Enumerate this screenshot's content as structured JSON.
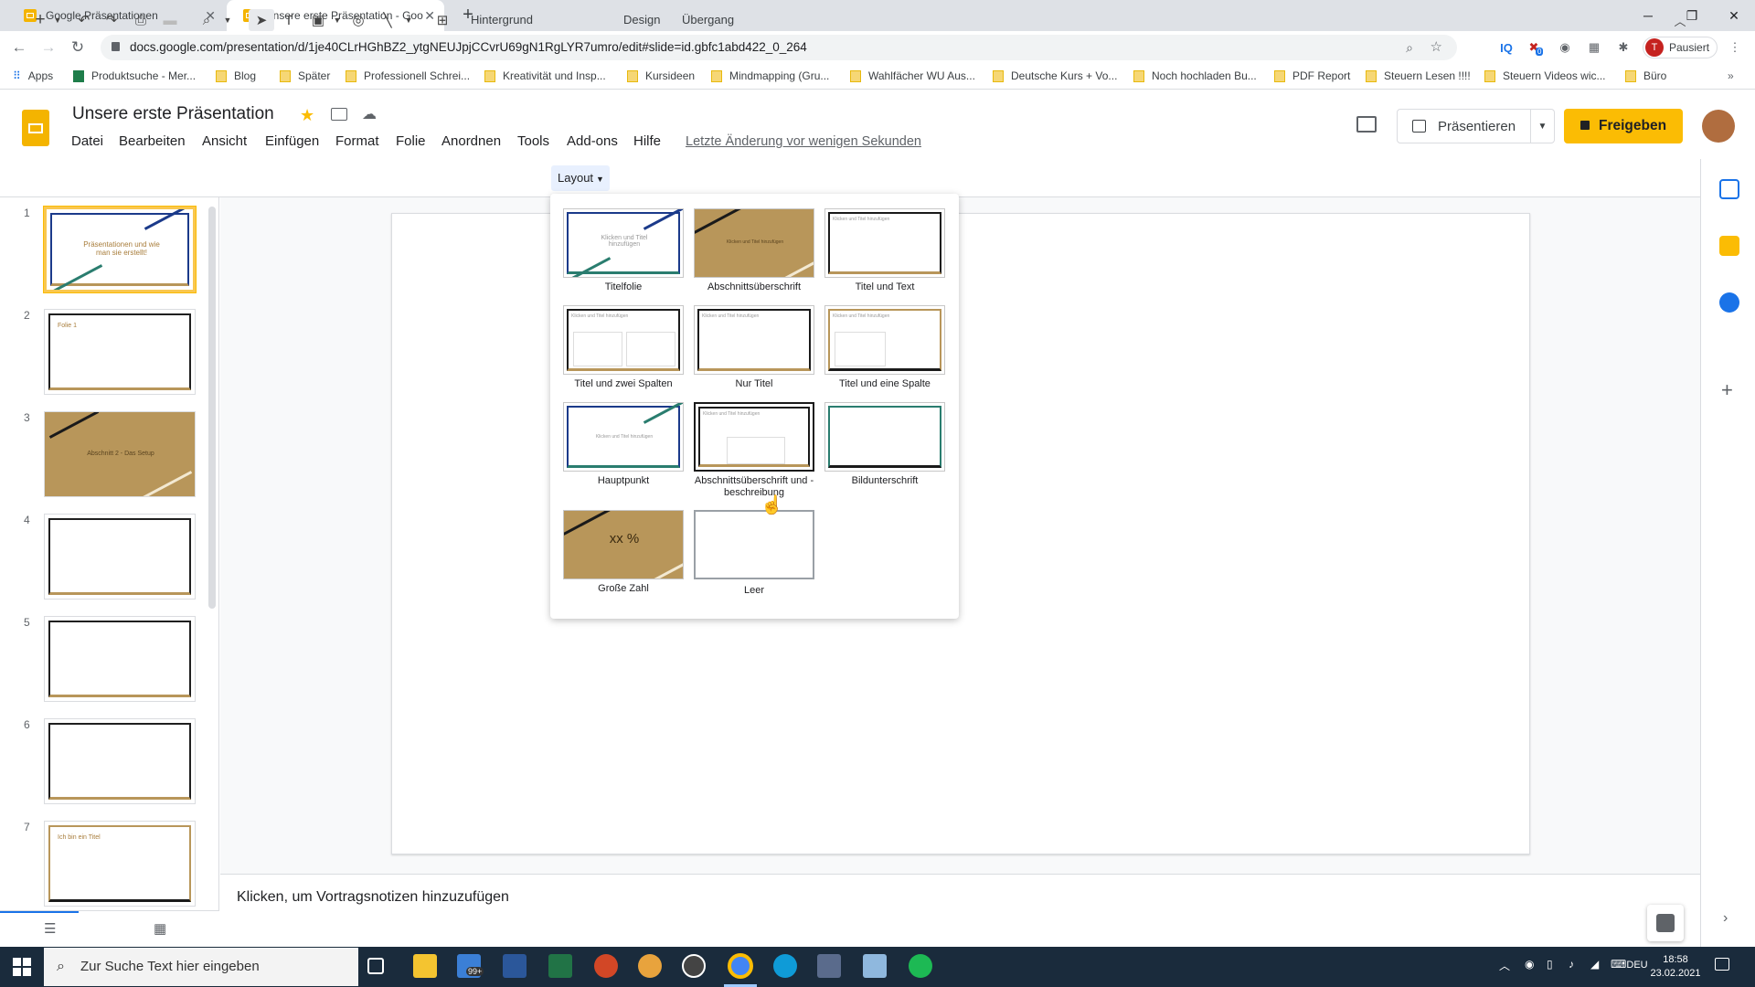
{
  "browser": {
    "tabs": [
      {
        "title": "Google Präsentationen",
        "active": false
      },
      {
        "title": "Unsere erste Präsentation - Goo",
        "active": true
      }
    ],
    "url": "docs.google.com/presentation/d/1je40CLrHGhBZ2_ytgNEUJpjCCvrU69gN1RgLYR7umro/edit#slide=id.gbfc1abd422_0_264",
    "profile_initial": "T",
    "profile_label": "Pausiert",
    "ext_badge": "0",
    "bookmarks": [
      "Apps",
      "Produktsuche - Mer...",
      "Blog",
      "Später",
      "Professionell Schrei...",
      "Kreativität und Insp...",
      "Kursideen",
      "Mindmapping  (Gru...",
      "Wahlfächer WU Aus...",
      "Deutsche Kurs + Vo...",
      "Noch hochladen Bu...",
      "PDF Report",
      "Steuern Lesen !!!!",
      "Steuern Videos wic...",
      "Büro"
    ]
  },
  "app": {
    "doc_title": "Unsere erste Präsentation",
    "menus": [
      "Datei",
      "Bearbeiten",
      "Ansicht",
      "Einfügen",
      "Format",
      "Folie",
      "Anordnen",
      "Tools",
      "Add-ons",
      "Hilfe"
    ],
    "last_edit": "Letzte Änderung vor wenigen Sekunden",
    "present_label": "Präsentieren",
    "share_label": "Freigeben"
  },
  "toolbar": {
    "background": "Hintergrund",
    "layout": "Layout",
    "design": "Design",
    "transition": "Übergang"
  },
  "filmstrip": {
    "slides": [
      {
        "num": "1",
        "text": "Präsentationen und wie man sie erstellt!"
      },
      {
        "num": "2",
        "text": "Folie 1"
      },
      {
        "num": "3",
        "text": "Abschnitt 2 - Das Setup"
      },
      {
        "num": "4",
        "text": ""
      },
      {
        "num": "5",
        "text": ""
      },
      {
        "num": "6",
        "text": ""
      },
      {
        "num": "7",
        "text": "Ich bin ein Titel"
      }
    ]
  },
  "layouts": [
    {
      "label": "Titelfolie",
      "preview": "Klicken und Titel hinzufügen"
    },
    {
      "label": "Abschnittsüberschrift",
      "preview": "Klicken und Titel hinzufügen"
    },
    {
      "label": "Titel und Text",
      "preview": "Klicken und Titel hinzufügen"
    },
    {
      "label": "Titel und zwei Spalten",
      "preview": "Klicken und Titel hinzufügen"
    },
    {
      "label": "Nur Titel",
      "preview": "Klicken und Titel hinzufügen"
    },
    {
      "label": "Titel und eine Spalte",
      "preview": "Klicken und Titel hinzufügen"
    },
    {
      "label": "Hauptpunkt",
      "preview": "Klicken und Titel hinzufügen"
    },
    {
      "label": "Abschnittsüberschrift und -beschreibung",
      "preview": "Klicken und Titel hinzufügen"
    },
    {
      "label": "Bildunterschrift",
      "preview": ""
    },
    {
      "label": "Große Zahl",
      "preview": "xx %"
    },
    {
      "label": "Leer",
      "preview": ""
    }
  ],
  "notes_placeholder": "Klicken, um Vortragsnotizen hinzuzufügen",
  "taskbar": {
    "search_placeholder": "Zur Suche Text hier eingeben",
    "mail_badge": "99+",
    "lang": "DEU",
    "time": "18:58",
    "date": "23.02.2021"
  },
  "colors": {
    "accent": "#fbbc04",
    "slide_gold": "#b8965a",
    "taskbar": "#1a2b3c"
  }
}
